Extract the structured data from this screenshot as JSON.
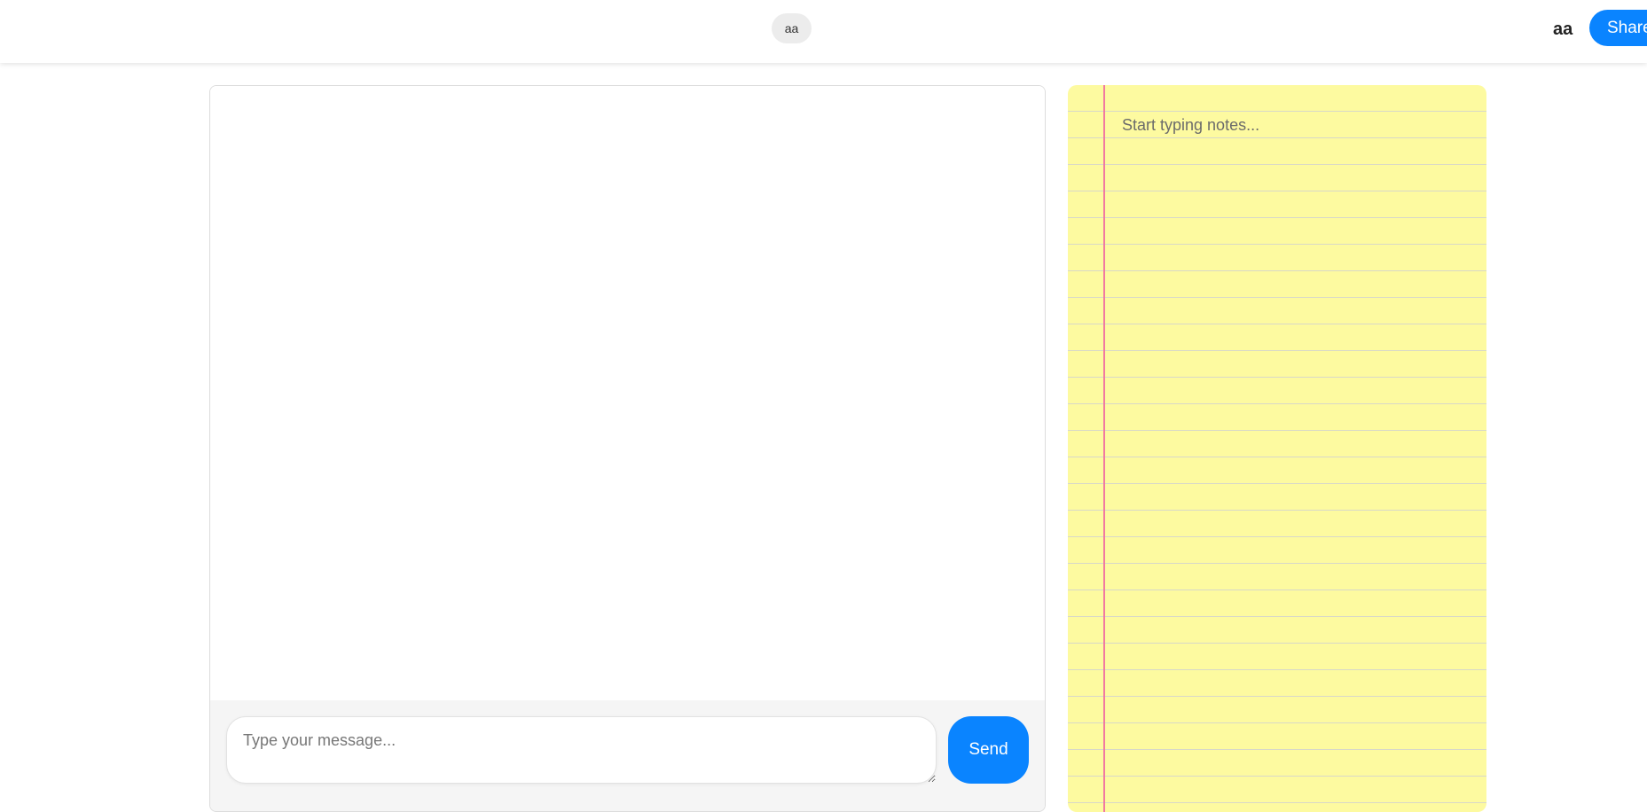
{
  "header": {
    "room_label": "aa",
    "username": "aa",
    "share_label": "Share"
  },
  "chat": {
    "input_placeholder": "Type your message...",
    "input_value": "",
    "send_label": "Send"
  },
  "notes": {
    "placeholder": "Start typing notes...",
    "value": ""
  },
  "colors": {
    "accent": "#0a84ff",
    "notes_paper": "#fdfaa0",
    "notes_margin": "#f17aa1",
    "composer_bg": "#f5f5f5"
  }
}
